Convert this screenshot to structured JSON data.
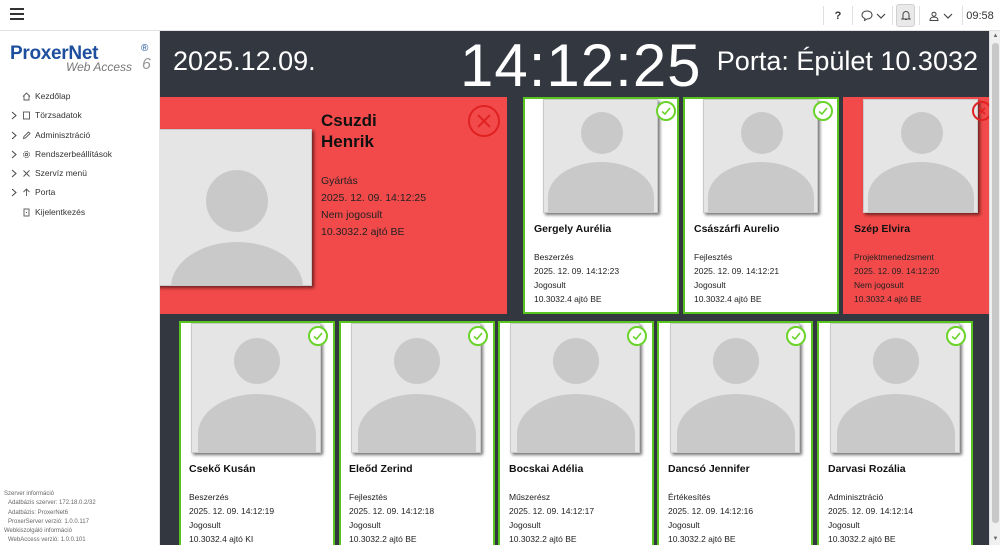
{
  "topbar": {
    "help_label": "?",
    "time": "09:58"
  },
  "logo": {
    "main": "ProxerNet",
    "registered": "®",
    "sub": "Web Access",
    "version_mark": "6"
  },
  "sidebar": {
    "items": [
      {
        "label": "Kezdőlap",
        "icon": "home-icon",
        "expandable": false
      },
      {
        "label": "Törzsadatok",
        "icon": "document-icon",
        "expandable": true
      },
      {
        "label": "Adminisztráció",
        "icon": "pencil-icon",
        "expandable": true
      },
      {
        "label": "Rendszerbeállítások",
        "icon": "gear-icon",
        "expandable": true
      },
      {
        "label": "Szervíz menü",
        "icon": "wrench-icon",
        "expandable": true
      },
      {
        "label": "Porta",
        "icon": "door-icon",
        "expandable": true
      },
      {
        "label": "Kijelentkezés",
        "icon": "logout-icon",
        "expandable": false
      }
    ],
    "server_info": {
      "title": "Szerver információ",
      "db_server": "Adatbázis szerver: 172.18.0.2/32",
      "database": "Adatbázis: ProxerNet6",
      "proxerserver_version": "ProxerServer verzió: 1.0.0.117",
      "webserver_title": "Webkiszolgáló információ",
      "webaccess_version": "WebAccess verzió: 1.0.0.101"
    }
  },
  "header": {
    "date": "2025.12.09.",
    "clock": "14:12:25",
    "location": "Porta: Épület 10.3032"
  },
  "cards": [
    {
      "name_line1": "Csuzdi",
      "name_line2": "Henrik",
      "department": "Gyártás",
      "timestamp": "2025. 12. 09. 14:12:25",
      "status": "Nem jogosult",
      "door": "10.3032.2 ajtó BE",
      "authorized": false
    },
    {
      "name": "Gergely Aurélia",
      "department": "Beszerzés",
      "timestamp": "2025. 12. 09. 14:12:23",
      "status": "Jogosult",
      "door": "10.3032.4 ajtó BE",
      "authorized": true
    },
    {
      "name": "Császárfi Aurelio",
      "department": "Fejlesztés",
      "timestamp": "2025. 12. 09. 14:12:21",
      "status": "Jogosult",
      "door": "10.3032.4 ajtó BE",
      "authorized": true
    },
    {
      "name": "Szép Elvira",
      "department": "Projektmenedzsment",
      "timestamp": "2025. 12. 09. 14:12:20",
      "status": "Nem jogosult",
      "door": "10.3032.4 ajtó BE",
      "authorized": false
    },
    {
      "name": "Csekő Kusán",
      "department": "Beszerzés",
      "timestamp": "2025. 12. 09. 14:12:19",
      "status": "Jogosult",
      "door": "10.3032.4 ajtó KI",
      "authorized": true
    },
    {
      "name": "Eleőd Zerind",
      "department": "Fejlesztés",
      "timestamp": "2025. 12. 09. 14:12:18",
      "status": "Jogosult",
      "door": "10.3032.2 ajtó BE",
      "authorized": true
    },
    {
      "name": "Bocskai Adélia",
      "department": "Műszerész",
      "timestamp": "2025. 12. 09. 14:12:17",
      "status": "Jogosult",
      "door": "10.3032.2 ajtó BE",
      "authorized": true
    },
    {
      "name": "Dancsó Jennifer",
      "department": "Értékesítés",
      "timestamp": "2025. 12. 09. 14:12:16",
      "status": "Jogosult",
      "door": "10.3032.2 ajtó BE",
      "authorized": true
    },
    {
      "name": "Darvasi Rozália",
      "department": "Adminisztráció",
      "timestamp": "2025. 12. 09. 14:12:14",
      "status": "Jogosult",
      "door": "10.3032.2 ajtó BE",
      "authorized": true
    }
  ],
  "colors": {
    "authorized_border": "#58c41f",
    "denied_background": "#f24a4a",
    "brand": "#1e4f9e",
    "dark_background": "#333840"
  }
}
